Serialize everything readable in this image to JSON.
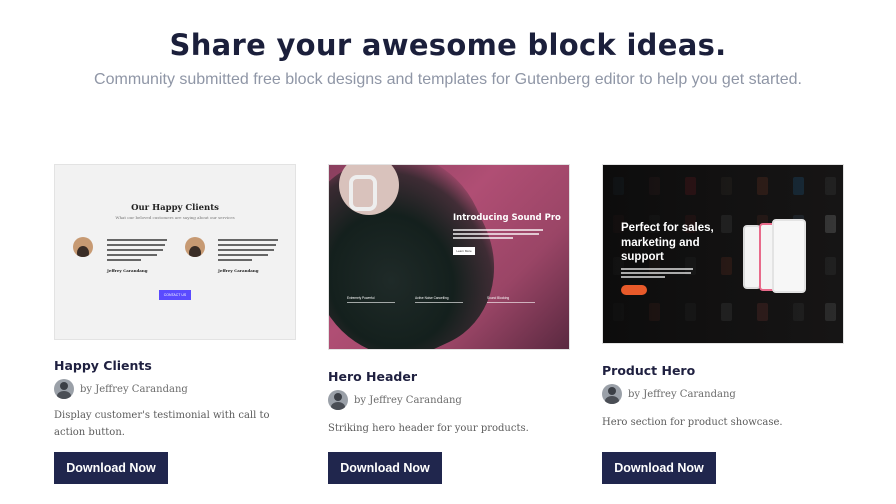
{
  "header": {
    "title": "Share your awesome block ideas.",
    "subtitle": "Community submitted free block designs and templates for Gutenberg editor to help you get started."
  },
  "cards": [
    {
      "title": "Happy Clients",
      "author": "by Jeffrey Carandang",
      "description": "Display customer's testimonial with call to action button.",
      "button": "Download Now",
      "thumb": {
        "heading": "Our Happy Clients",
        "sub": "What our beloved customers are saying about our services",
        "name": "Jeffrey Carandang",
        "cta": "CONTACT US"
      }
    },
    {
      "title": "Hero Header",
      "author": "by Jeffrey Carandang",
      "description": "Striking hero header for your products.",
      "button": "Download Now",
      "thumb": {
        "heading": "Introducing Sound Pro",
        "cta": "Learn More",
        "features": [
          "Extremely Powerful",
          "Active Noise Cancelling",
          "Sound Blocking"
        ]
      }
    },
    {
      "title": "Product Hero",
      "author": "by Jeffrey Carandang",
      "description": "Hero section for product showcase.",
      "button": "Download Now",
      "thumb": {
        "heading": "Perfect for sales, marketing and support"
      }
    }
  ],
  "colors": {
    "title": "#1b1f3b",
    "subtitle": "#8f96a6",
    "button": "#20264d",
    "cta_purple": "#5a4bff",
    "cta_orange": "#e85a2a"
  }
}
